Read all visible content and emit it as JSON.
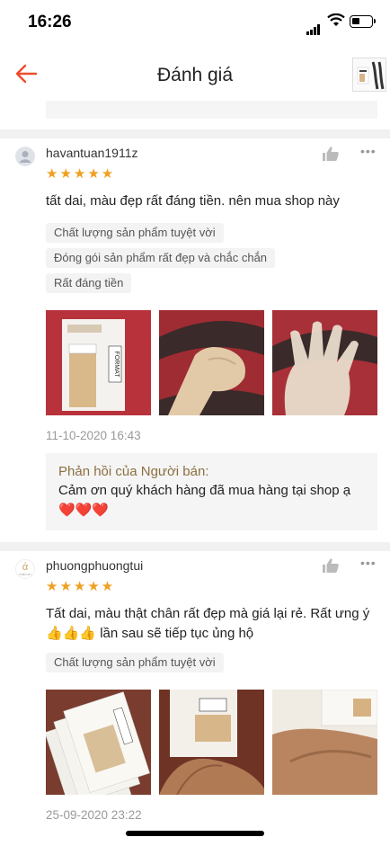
{
  "status": {
    "time": "16:26"
  },
  "header": {
    "title": "Đánh giá"
  },
  "reviews": [
    {
      "username": "havantuan1911z",
      "stars": "★★★★★",
      "text": "tất dai, màu đẹp rất đáng tiền. nên mua shop này",
      "tags": [
        "Chất lượng sản phẩm tuyệt vời",
        "Đóng gói sản phẩm rất đẹp và chắc chắn",
        "Rất đáng tiền"
      ],
      "date": "11-10-2020 16:43",
      "reply": {
        "title": "Phản hồi của Người bán:",
        "text": "Cảm ơn quý khách hàng đã mua hàng tại shop ạ",
        "hearts": "❤️❤️❤️"
      }
    },
    {
      "username": "phuongphuongtui",
      "avatar_text": "TRIỀU MY",
      "stars": "★★★★★",
      "text": "Tất dai, màu thật chân rất đẹp mà giá lại rẻ. Rất ưng ý 👍👍👍 lần sau sẽ tiếp tục ủng hộ",
      "tags": [
        "Chất lượng sản phẩm tuyệt vời"
      ],
      "date": "25-09-2020 23:22"
    }
  ],
  "product_label": "FORMAT",
  "colors": {
    "accent": "#ee4d2d",
    "star": "#f0a020",
    "reply_title": "#8b6f40"
  }
}
